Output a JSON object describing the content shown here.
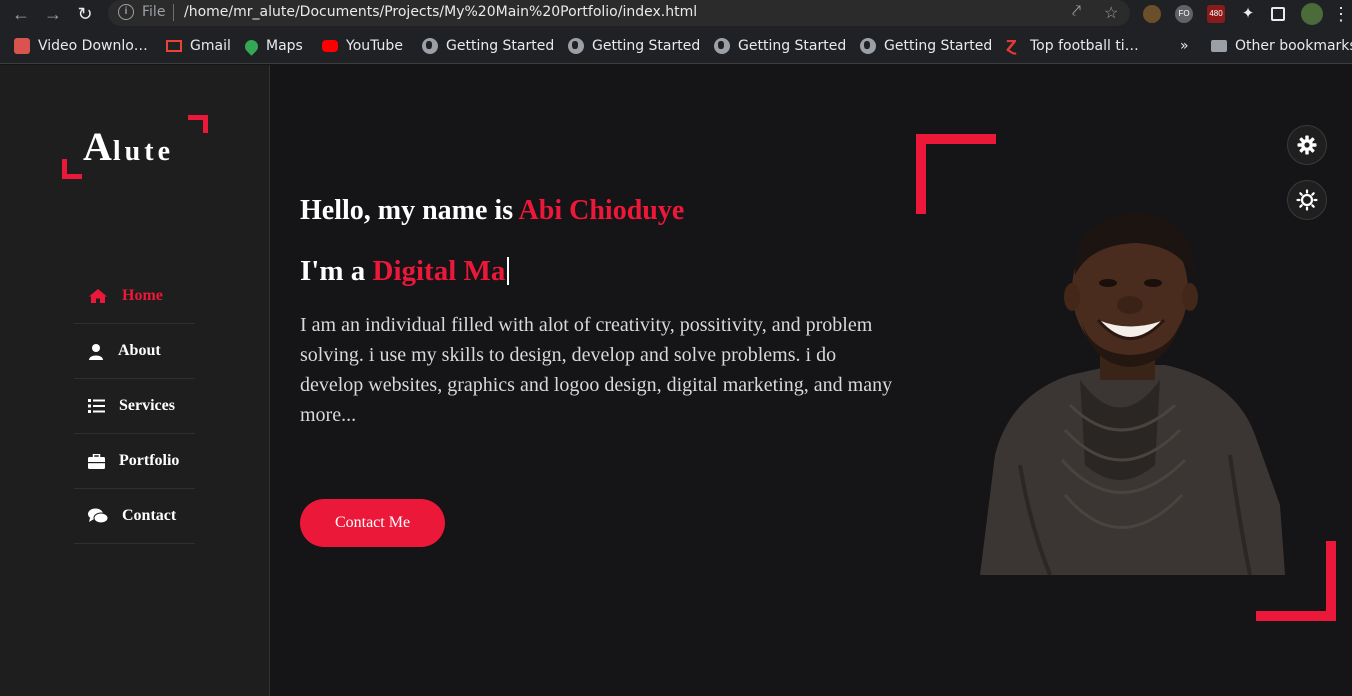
{
  "browser": {
    "url_scheme": "File",
    "url": "/home/mr_alute/Documents/Projects/My%20Main%20Portfolio/index.html",
    "bookmarks": [
      {
        "label": "Video Downlo…",
        "icon": "video-downloader-icon"
      },
      {
        "label": "Gmail",
        "icon": "gmail-icon"
      },
      {
        "label": "Maps",
        "icon": "maps-icon"
      },
      {
        "label": "YouTube",
        "icon": "youtube-icon"
      },
      {
        "label": "Getting Started",
        "icon": "globe-icon"
      },
      {
        "label": "Getting Started",
        "icon": "globe-icon"
      },
      {
        "label": "Getting Started",
        "icon": "globe-icon"
      },
      {
        "label": "Getting Started",
        "icon": "globe-icon"
      },
      {
        "label": "Top football ti…",
        "icon": "football-icon"
      }
    ],
    "more_bookmarks": "»",
    "other_bookmarks": "Other bookmarks",
    "extensions": [
      "FO",
      "480"
    ]
  },
  "sidebar": {
    "logo_first": "A",
    "logo_rest": "lute",
    "nav": [
      {
        "label": "Home",
        "icon": "home-icon",
        "active": true
      },
      {
        "label": "About",
        "icon": "user-icon",
        "active": false
      },
      {
        "label": "Services",
        "icon": "list-icon",
        "active": false
      },
      {
        "label": "Portfolio",
        "icon": "briefcase-icon",
        "active": false
      },
      {
        "label": "Contact",
        "icon": "comments-icon",
        "active": false
      }
    ]
  },
  "hero": {
    "hello_prefix": "Hello, my name is ",
    "name": "Abi Chioduye",
    "role_prefix": "I'm a ",
    "role_typed": "Digital Ma",
    "bio": "I am an individual filled with alot of creativity, possitivity, and problem solving. i use my skills to design, develop and solve problems. i do develop websites, graphics and logoo design, digital marketing, and many more...",
    "cta": "Contact Me"
  },
  "colors": {
    "accent": "#ec1839",
    "background": "#151416",
    "sidebar": "#1e1e1f"
  }
}
